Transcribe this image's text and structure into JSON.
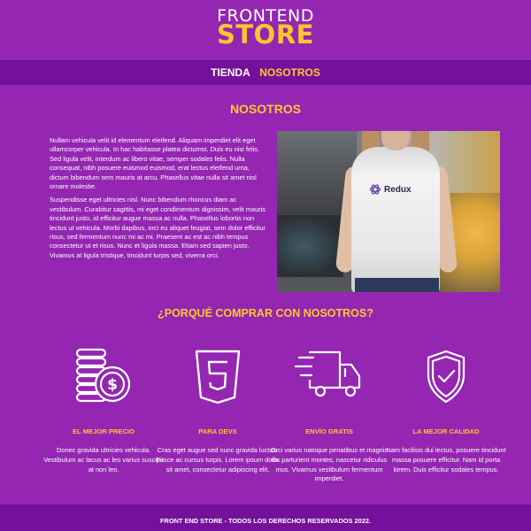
{
  "header": {
    "logo_top": "FRONTEND",
    "logo_bottom": "STORE"
  },
  "nav": {
    "items": [
      {
        "label": "TIENDA",
        "active": false
      },
      {
        "label": "NOSOTROS",
        "active": true
      }
    ]
  },
  "about": {
    "title": "NOSOTROS",
    "paragraphs": [
      "Nullam vehicula velit id elementum eleifend. Aliquam imperdiet elit eget ullamcorper vehicula. In hac habitasse platea dictumst. Duis eu nisi felis. Sed ligula velit, interdum ac libero vitae, semper sodales felis. Nulla consequat, nibh posuere euismod euismod, erat lectus eleifend urna, dictum bibendum sem mauris at arcu. Phasellus vitae nulla sit amet nisl ornare molestie.",
      "Suspendisse eget ultricies nisl. Nunc bibendum rhoncus diam ac vestibulum. Curabitur sagittis, mi eget condimentum dignissim, velit mauris tincidunt justo, id efficitur augue massa ac nulla. Phasellus lobortis non lectus ut vehicula. Morbi dapibus, orci eu aliquet feugiat, sem dolor efficitur risus, sed fermentum nunc mi ac mi. Praesent ac est ac nibh tempus consectetur ut et risus. Nunc et ligula massa. Etiam sed sapien justo. Vivamus at ligula tristique, tincidunt turpis sed, viverra orci."
    ],
    "image_shirt_label": "Redux"
  },
  "why": {
    "title": "¿PORQUÉ COMPRAR CON NOSOTROS?",
    "features": [
      {
        "icon": "coins-dollar-icon",
        "title": "EL MEJOR PRECIO",
        "description": "Donec gravida ultricies vehicula. Vestibulum ac lacus ac leo varius suscipit at non leo."
      },
      {
        "icon": "html5-icon",
        "title": "PARA DEVS",
        "description": "Cras eget augue sed nunc gravida luctus. Fusce ac cursus turpis. Lorem ipsum dolor sit amet, consectetur adipiscing elit."
      },
      {
        "icon": "delivery-truck-icon",
        "title": "ENVÍO GRATIS",
        "description": "Orci varius natoque penatibus et magnis dis parturient montes, nascetur ridiculus mus. Vivamus vestibulum fermentum imperdiet."
      },
      {
        "icon": "shield-check-icon",
        "title": "LA MEJOR CALIDAD",
        "description": "Nam facilisis dui lectus, posuere tincidunt massa posuere efficitur. Nam id porta lorem. Duis efficitur sodales tempus."
      }
    ]
  },
  "footer": {
    "text": "FRONT END STORE - TODOS LOS DERECHOS RESERVADOS 2022."
  },
  "colors": {
    "background": "#9426b2",
    "bar": "#74109a",
    "accent": "#fec72f",
    "text": "#ffffff"
  }
}
